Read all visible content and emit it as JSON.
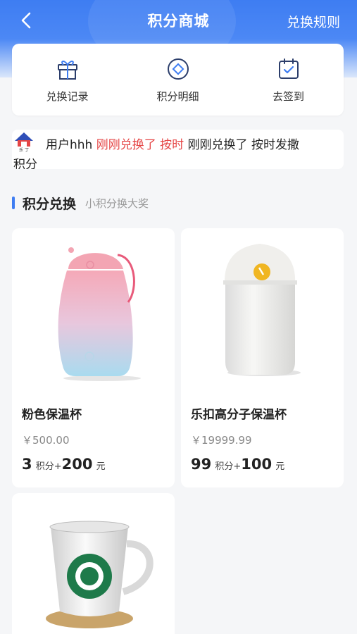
{
  "header": {
    "title": "积分商城",
    "rules_label": "兑换规则",
    "back_icon": "chevron-left-icon"
  },
  "quick_menu": [
    {
      "label": "兑换记录",
      "icon": "gift-icon"
    },
    {
      "label": "积分明细",
      "icon": "coin-icon"
    },
    {
      "label": "去签到",
      "icon": "calendar-check-icon"
    }
  ],
  "notice": {
    "logo_text": "乐 丁",
    "user": "用户hhh",
    "action_red": "刚刚兑换了 按时",
    "rest_line1": "刚刚兑换了 按时发撒",
    "rest_line2": "积分"
  },
  "section": {
    "title": "积分兑换",
    "subtitle": "小积分换大奖"
  },
  "products": [
    {
      "name": "粉色保温杯",
      "price": "￥500.00",
      "points": "3",
      "points_unit": "积分",
      "plus": "+",
      "cash": "200",
      "cash_unit": "元"
    },
    {
      "name": "乐扣高分子保温杯",
      "price": "￥19999.99",
      "points": "99",
      "points_unit": "积分",
      "plus": "+",
      "cash": "100",
      "cash_unit": "元"
    },
    {
      "name": "",
      "price": "",
      "points": "",
      "points_unit": "",
      "plus": "",
      "cash": "",
      "cash_unit": ""
    }
  ],
  "colors": {
    "primary": "#3e7df2",
    "highlight": "#e54545"
  }
}
